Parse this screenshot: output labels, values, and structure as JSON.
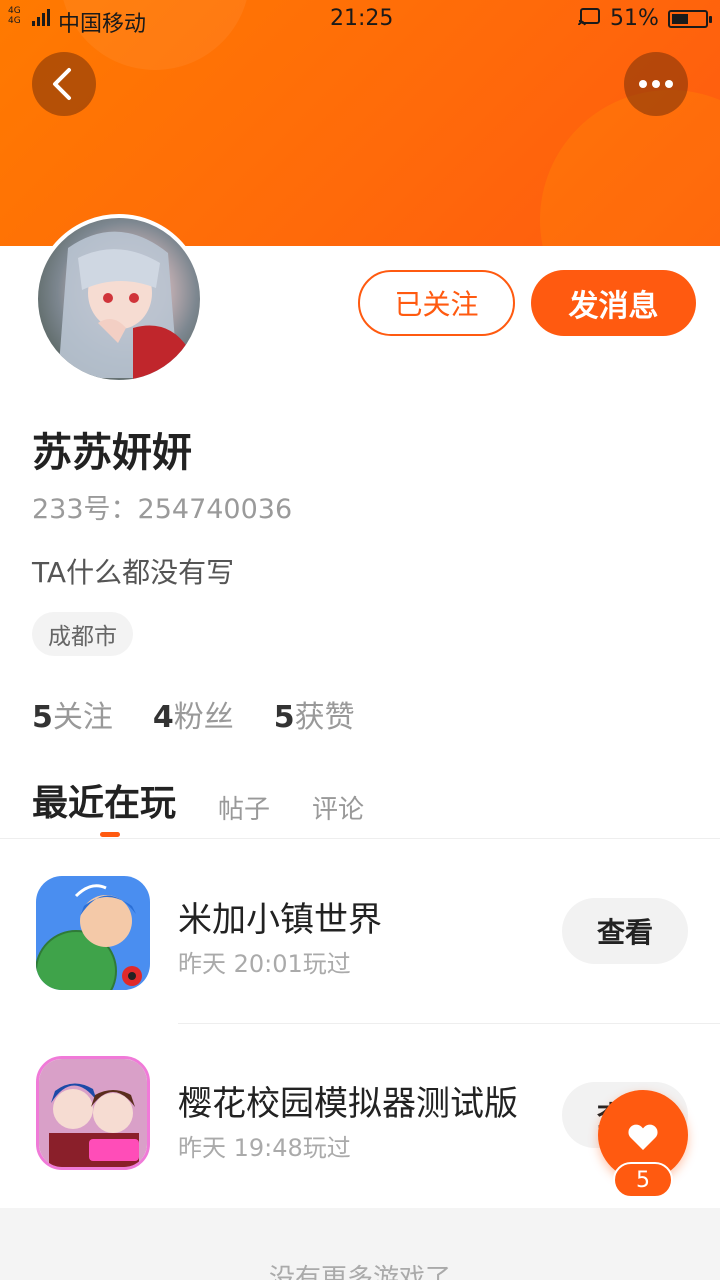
{
  "status_bar": {
    "network": "4G 4G",
    "carrier": "中国移动",
    "time": "21:25",
    "battery": "51%",
    "battery_level": 0.51
  },
  "header": {
    "back_icon": "chevron-left-icon",
    "more_icon": "more-horizontal-icon",
    "accent_color": "#ff5a10"
  },
  "profile": {
    "follow_button_label": "已关注",
    "message_button_label": "发消息",
    "name": "苏苏妍妍",
    "id_label": "233号：254740036",
    "bio": "TA什么都没有写",
    "location": "成都市",
    "stats": [
      {
        "count": "5",
        "label": "关注"
      },
      {
        "count": "4",
        "label": "粉丝"
      },
      {
        "count": "5",
        "label": "获赞"
      }
    ]
  },
  "tabs": [
    {
      "label": "最近在玩",
      "active": true
    },
    {
      "label": "帖子",
      "active": false
    },
    {
      "label": "评论",
      "active": false
    }
  ],
  "games": [
    {
      "title": "米加小镇世界",
      "meta": "昨天 20:01玩过",
      "button": "查看"
    },
    {
      "title": "樱花校园模拟器测试版",
      "meta": "昨天 19:48玩过",
      "button": "查看"
    }
  ],
  "footer": {
    "text": "没有更多游戏了"
  },
  "like": {
    "count": "5",
    "icon": "heart-icon"
  }
}
